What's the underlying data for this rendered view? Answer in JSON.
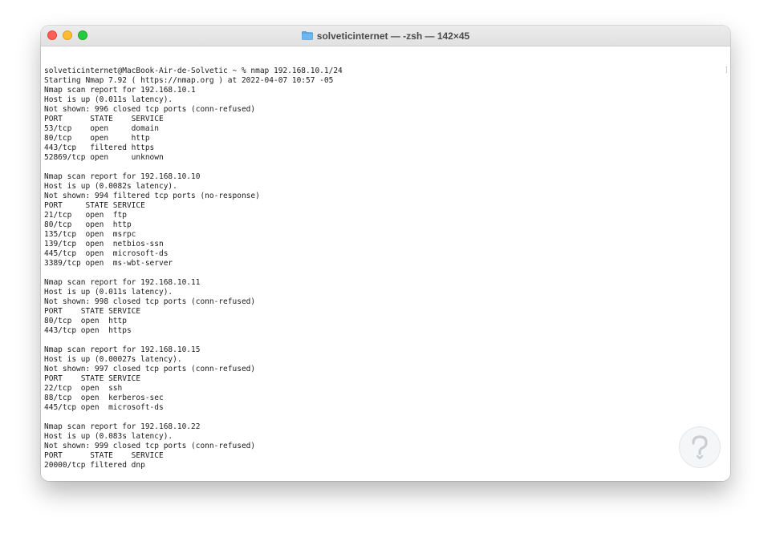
{
  "window": {
    "title": "solveticinternet — -zsh — 142×45"
  },
  "terminal": {
    "lines": [
      "solveticinternet@MacBook-Air-de-Solvetic ~ % nmap 192.168.10.1/24",
      "Starting Nmap 7.92 ( https://nmap.org ) at 2022-04-07 10:57 -05",
      "Nmap scan report for 192.168.10.1",
      "Host is up (0.011s latency).",
      "Not shown: 996 closed tcp ports (conn-refused)",
      "PORT      STATE    SERVICE",
      "53/tcp    open     domain",
      "80/tcp    open     http",
      "443/tcp   filtered https",
      "52869/tcp open     unknown",
      "",
      "Nmap scan report for 192.168.10.10",
      "Host is up (0.0082s latency).",
      "Not shown: 994 filtered tcp ports (no-response)",
      "PORT     STATE SERVICE",
      "21/tcp   open  ftp",
      "80/tcp   open  http",
      "135/tcp  open  msrpc",
      "139/tcp  open  netbios-ssn",
      "445/tcp  open  microsoft-ds",
      "3389/tcp open  ms-wbt-server",
      "",
      "Nmap scan report for 192.168.10.11",
      "Host is up (0.011s latency).",
      "Not shown: 998 closed tcp ports (conn-refused)",
      "PORT    STATE SERVICE",
      "80/tcp  open  http",
      "443/tcp open  https",
      "",
      "Nmap scan report for 192.168.10.15",
      "Host is up (0.00027s latency).",
      "Not shown: 997 closed tcp ports (conn-refused)",
      "PORT    STATE SERVICE",
      "22/tcp  open  ssh",
      "88/tcp  open  kerberos-sec",
      "445/tcp open  microsoft-ds",
      "",
      "Nmap scan report for 192.168.10.22",
      "Host is up (0.083s latency).",
      "Not shown: 999 closed tcp ports (conn-refused)",
      "PORT      STATE    SERVICE",
      "20000/tcp filtered dnp"
    ]
  },
  "icons": {
    "title_folder": "folder-icon",
    "watermark": "solvetic-logo-icon"
  },
  "colors": {
    "close": "#fe5f57",
    "minimize": "#febc2e",
    "maximize": "#28c840",
    "folder": "#5aa9e6",
    "text": "#1a1a1a"
  }
}
